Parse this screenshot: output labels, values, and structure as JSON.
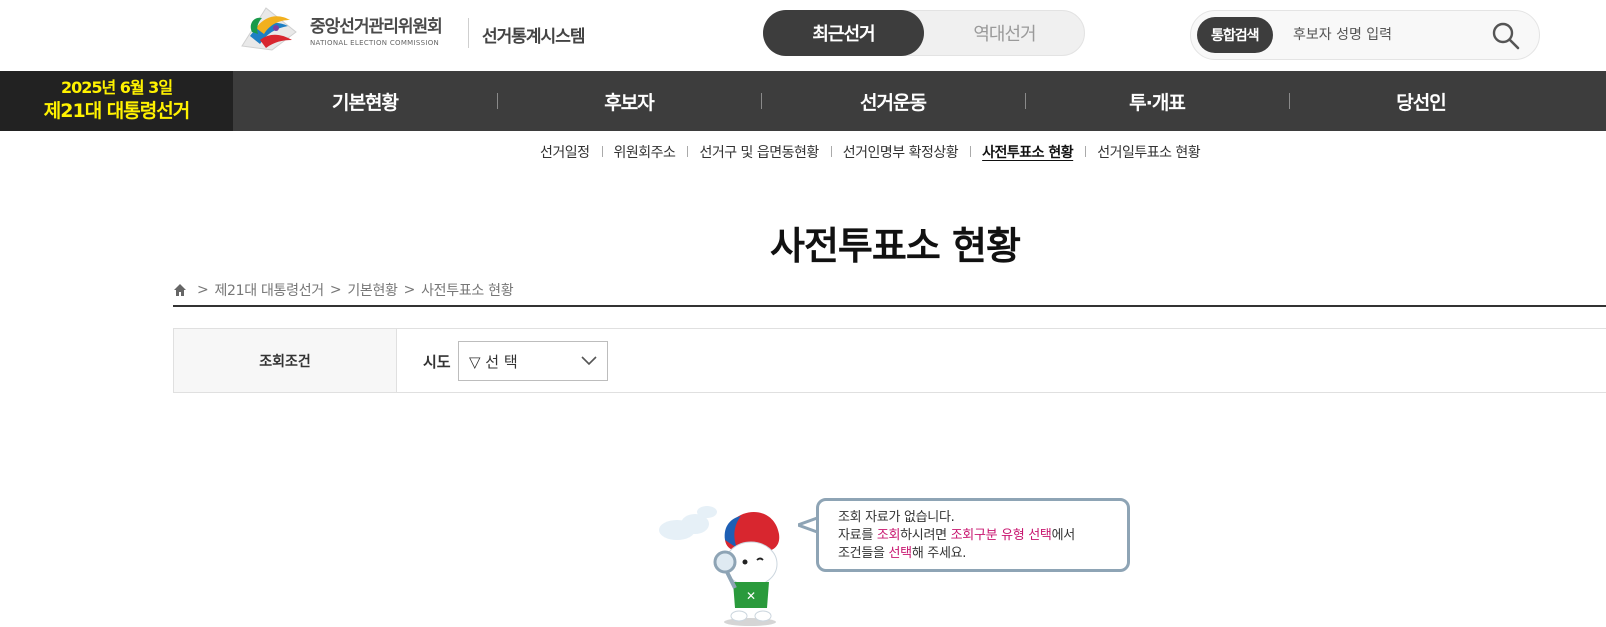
{
  "header": {
    "logo_kr": "중앙선거관리위원회",
    "logo_en": "NATIONAL ELECTION COMMISSION",
    "system_title": "선거통계시스템",
    "toggle": {
      "active": "최근선거",
      "inactive": "역대선거"
    },
    "search": {
      "badge": "통합검색",
      "placeholder": "후보자 성명 입력",
      "icon": "search-icon"
    }
  },
  "gnb": {
    "election_date": "2025년 6월 3일",
    "election_name": "제21대 대통령선거",
    "items": [
      "기본현황",
      "후보자",
      "선거운동",
      "투·개표",
      "당선인"
    ]
  },
  "subnav": {
    "items": [
      "선거일정",
      "위원회주소",
      "선거구 및 읍면동현황",
      "선거인명부 확정상황",
      "사전투표소 현황",
      "선거일투표소 현황"
    ],
    "current": "사전투표소 현황"
  },
  "page": {
    "title": "사전투표소 현황",
    "breadcrumb": [
      "제21대 대통령선거",
      "기본현황",
      "사전투표소 현황"
    ],
    "breadcrumb_sep": ">"
  },
  "condition": {
    "label": "조회조건",
    "field_label": "시도",
    "select_value": "▽ 선 택"
  },
  "empty_state": {
    "line1": "조회 자료가 없습니다.",
    "line2_a": "자료를 ",
    "line2_hl1": "조회",
    "line2_b": "하시려면 ",
    "line2_hl2": "조회구분 유형 선택",
    "line2_c": "에서",
    "line3_a": "조건들을 ",
    "line3_hl": "선택",
    "line3_b": "해 주세요."
  },
  "colors": {
    "dark_bar": "#3d3d3d",
    "election_badge_bg": "#222222",
    "election_text": "#fff200",
    "highlight": "#c8156f",
    "bubble_border": "#8ea4b5"
  }
}
